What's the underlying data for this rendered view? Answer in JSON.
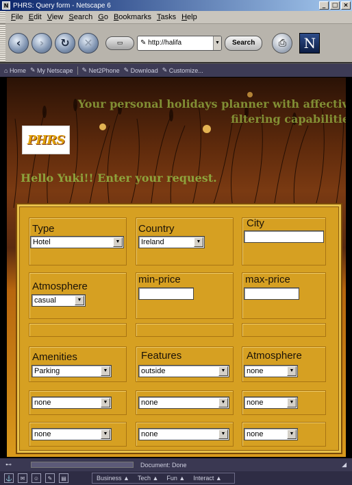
{
  "window": {
    "title": "PHRS: Query form - Netscape 6"
  },
  "menu": [
    "File",
    "Edit",
    "View",
    "Search",
    "Go",
    "Bookmarks",
    "Tasks",
    "Help"
  ],
  "nav": {
    "url": "http://halifa",
    "search_label": "Search"
  },
  "personal_toolbar": [
    "Home",
    "My Netscape",
    "Net2Phone",
    "Download",
    "Customize..."
  ],
  "page": {
    "heading": "Your personal holidays planner with affective filtering capabilities",
    "logo_text": "PHRS",
    "greeting": "Hello Yuki!! Enter your request."
  },
  "form": {
    "type": {
      "label": "Type",
      "value": "Hotel"
    },
    "country": {
      "label": "Country",
      "value": "Ireland"
    },
    "city": {
      "label": "City",
      "value": ""
    },
    "atmosphere": {
      "label": "Atmosphere",
      "value": "casual"
    },
    "min_price": {
      "label": "min-price",
      "value": ""
    },
    "max_price": {
      "label": "max-price",
      "value": ""
    },
    "amenities_label": "Amenities",
    "features_label": "Features",
    "atmosphere2_label": "Atmosphere",
    "amenities": [
      "Parking",
      "none",
      "none"
    ],
    "features": [
      "outside",
      "none",
      "none"
    ],
    "atmospheres": [
      "none",
      "none",
      "none"
    ]
  },
  "status": {
    "text": "Document: Done"
  },
  "taskbar": [
    "Business",
    "Tech",
    "Fun",
    "Interact"
  ]
}
